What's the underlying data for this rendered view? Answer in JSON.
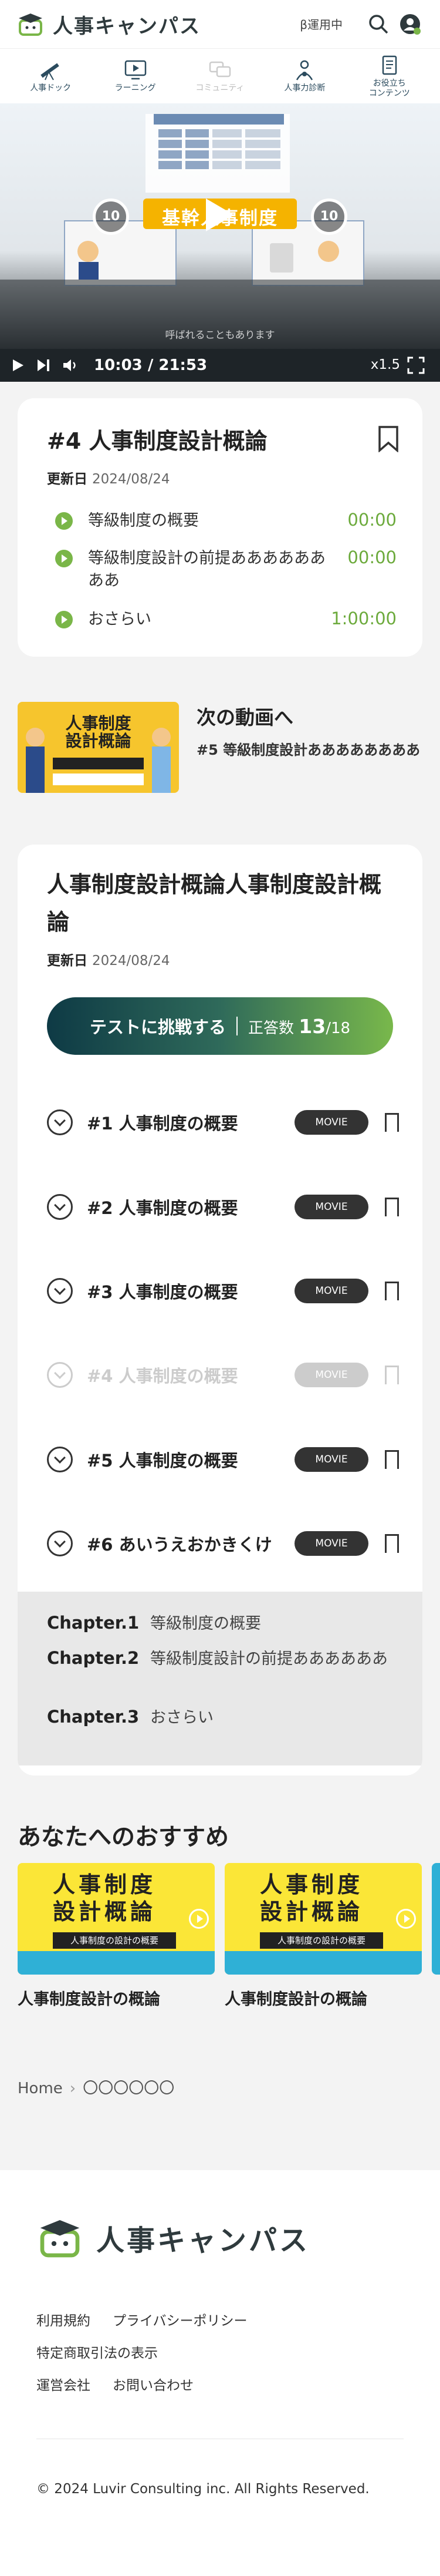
{
  "header": {
    "logo_text": "人事キャンパス",
    "beta_label": "β運用中"
  },
  "nav": [
    {
      "label": "人事ドック"
    },
    {
      "label": "ラーニング"
    },
    {
      "label": "コミュニティ"
    },
    {
      "label": "人事力診断"
    },
    {
      "label": "お役立ち\nコンテンツ"
    }
  ],
  "video": {
    "slide_title": "基幹人事制度",
    "skip_back": "10",
    "skip_forward": "10",
    "caption": "呼ばれることもあります",
    "time": "10:03 / 21:53",
    "speed": "x1.5",
    "progress_fraction": 0.46,
    "buffered_fraction": 0.65
  },
  "lesson": {
    "title": "#4 人事制度設計概論",
    "updated_label": "更新日",
    "updated_date": "2024/08/24",
    "toc": [
      {
        "label": "等級制度の概要",
        "time": "00:00"
      },
      {
        "label": "等級制度設計の前提ああああああああ",
        "time": "00:00"
      },
      {
        "label": "おさらい",
        "time": "1:00:00"
      }
    ]
  },
  "next": {
    "thumb_tag": "人事制度\n設計概論",
    "label": "次の動画へ",
    "title": "#5 等級制度設計ああああああああ"
  },
  "course": {
    "title": "人事制度設計概論人事制度設計概論",
    "updated_label": "更新日",
    "updated_date": "2024/08/24",
    "test_button": "テストに挑戦する",
    "score_label": "正答数",
    "score_value": "13",
    "score_total": "/18",
    "lessons": [
      {
        "name": "#1 人事制度の概要",
        "badge": "MOVIE"
      },
      {
        "name": "#2 人事制度の概要",
        "badge": "MOVIE"
      },
      {
        "name": "#3 人事制度の概要",
        "badge": "MOVIE"
      },
      {
        "name": "#4 人事制度の概要",
        "badge": "MOVIE"
      },
      {
        "name": "#5 人事制度の概要",
        "badge": "MOVIE"
      },
      {
        "name": "#6 あいうえおかきくけ",
        "badge": "MOVIE"
      }
    ],
    "chapters": [
      {
        "chapter": "Chapter.1",
        "title": "等級制度の概要"
      },
      {
        "chapter": "Chapter.2",
        "title": "等級制度設計の前提ああああああ"
      },
      {
        "chapter": "Chapter.3",
        "title": "おさらい"
      }
    ]
  },
  "recommend": {
    "title": "あなたへのおすすめ",
    "items": [
      {
        "thumb_title": "人事制度\n設計概論",
        "band": "人事制度の設計の概要",
        "name": "人事制度設計の概論"
      },
      {
        "thumb_title": "人事制度\n設計概論",
        "band": "人事制度の設計の概要",
        "name": "人事制度設計の概論"
      }
    ]
  },
  "breadcrumb": {
    "home": "Home",
    "current": "〇〇〇〇〇〇"
  },
  "footer": {
    "logo_text": "人事キャンパス",
    "links": [
      "利用規約",
      "プライバシーポリシー",
      "特定商取引法の表示",
      "運営会社",
      "お問い合わせ"
    ],
    "copyright": "© 2024 Luvir Consulting inc. All Rights Reserved."
  },
  "colors": {
    "accent_green": "#7ab648",
    "brand_dark": "#2f3a3d",
    "video_band": "#f5b300"
  }
}
